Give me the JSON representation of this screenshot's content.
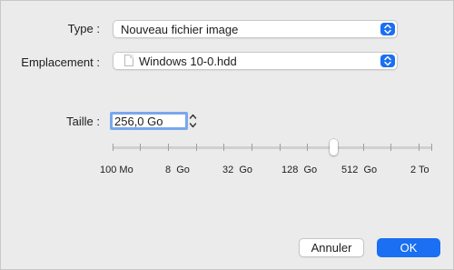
{
  "type_field": {
    "label": "Type :",
    "value": "Nouveau fichier image"
  },
  "location_field": {
    "label": "Emplacement :",
    "value": "Windows 10-0.hdd",
    "icon": "document-icon"
  },
  "size_field": {
    "label": "Taille :",
    "value": "256,0 Go",
    "slider_ticks": [
      "100 Mo",
      "8  Go",
      "32  Go",
      "128  Go",
      "512  Go",
      "2 To"
    ]
  },
  "buttons": {
    "cancel": "Annuler",
    "ok": "OK"
  },
  "colors": {
    "accent": "#1a6ff2",
    "background": "#ebebeb"
  }
}
